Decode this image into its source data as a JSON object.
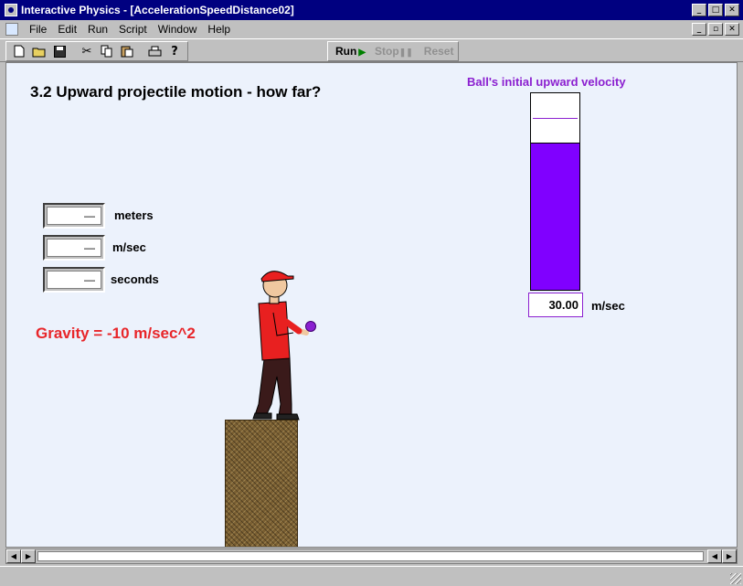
{
  "window": {
    "title": "Interactive Physics - [AccelerationSpeedDistance02]",
    "minimize_glyph": "_",
    "maximize_glyph": "□",
    "close_glyph": "✕",
    "restore_glyph": "▫"
  },
  "menu": {
    "items": [
      {
        "label": "File",
        "underline": "F"
      },
      {
        "label": "Edit",
        "underline": "E"
      },
      {
        "label": "Run",
        "underline": "R"
      },
      {
        "label": "Script",
        "underline": "S"
      },
      {
        "label": "Window",
        "underline": "W"
      },
      {
        "label": "Help",
        "underline": "H"
      }
    ]
  },
  "toolbar": {
    "icons": [
      "new-file-icon",
      "open-folder-icon",
      "save-disk-icon",
      "cut-scissors-icon",
      "copy-icon",
      "paste-icon",
      "print-icon",
      "help-icon"
    ],
    "run_label": "Run",
    "stop_label": "Stop",
    "reset_label": "Reset"
  },
  "canvas": {
    "title": "3.2 Upward projectile motion - how far?",
    "meters": [
      {
        "value": "—",
        "unit": "meters"
      },
      {
        "value": "—",
        "unit": "m/sec"
      },
      {
        "value": "—",
        "unit": "seconds"
      }
    ],
    "gravity_text": "Gravity = -10 m/sec^2",
    "slider": {
      "title": "Ball's initial upward velocity",
      "value": "30.00",
      "unit": "m/sec",
      "fill_fraction": 0.75,
      "color": "#8000ff"
    }
  }
}
